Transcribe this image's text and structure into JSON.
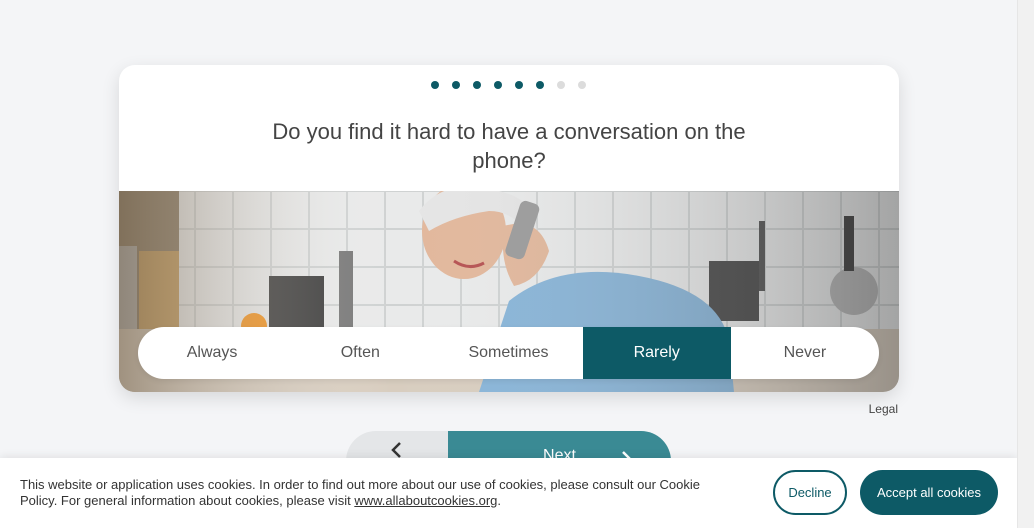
{
  "progress": {
    "total": 8,
    "completed": 6
  },
  "question": "Do you find it hard to have a conversation on the phone?",
  "photo": {
    "description_icon": "woman-on-phone-kitchen-photo"
  },
  "options": [
    {
      "label": "Always",
      "selected": false
    },
    {
      "label": "Often",
      "selected": false
    },
    {
      "label": "Sometimes",
      "selected": false
    },
    {
      "label": "Rarely",
      "selected": true
    },
    {
      "label": "Never",
      "selected": false
    }
  ],
  "legal_link": "Legal",
  "nav": {
    "next_label": "Next",
    "back_icon": "chevron-left-icon",
    "next_icon": "chevron-right-icon"
  },
  "cookie": {
    "text_before": "This website or application uses cookies. In order to find out more about our use of cookies, please consult our Cookie Policy. For general information about cookies, please visit ",
    "link": "www.allaboutcookies.org",
    "text_after": ".",
    "decline_label": "Decline",
    "accept_label": "Accept all cookies"
  },
  "colors": {
    "accent": "#0d5a66",
    "next_button": "#3a8a94"
  }
}
